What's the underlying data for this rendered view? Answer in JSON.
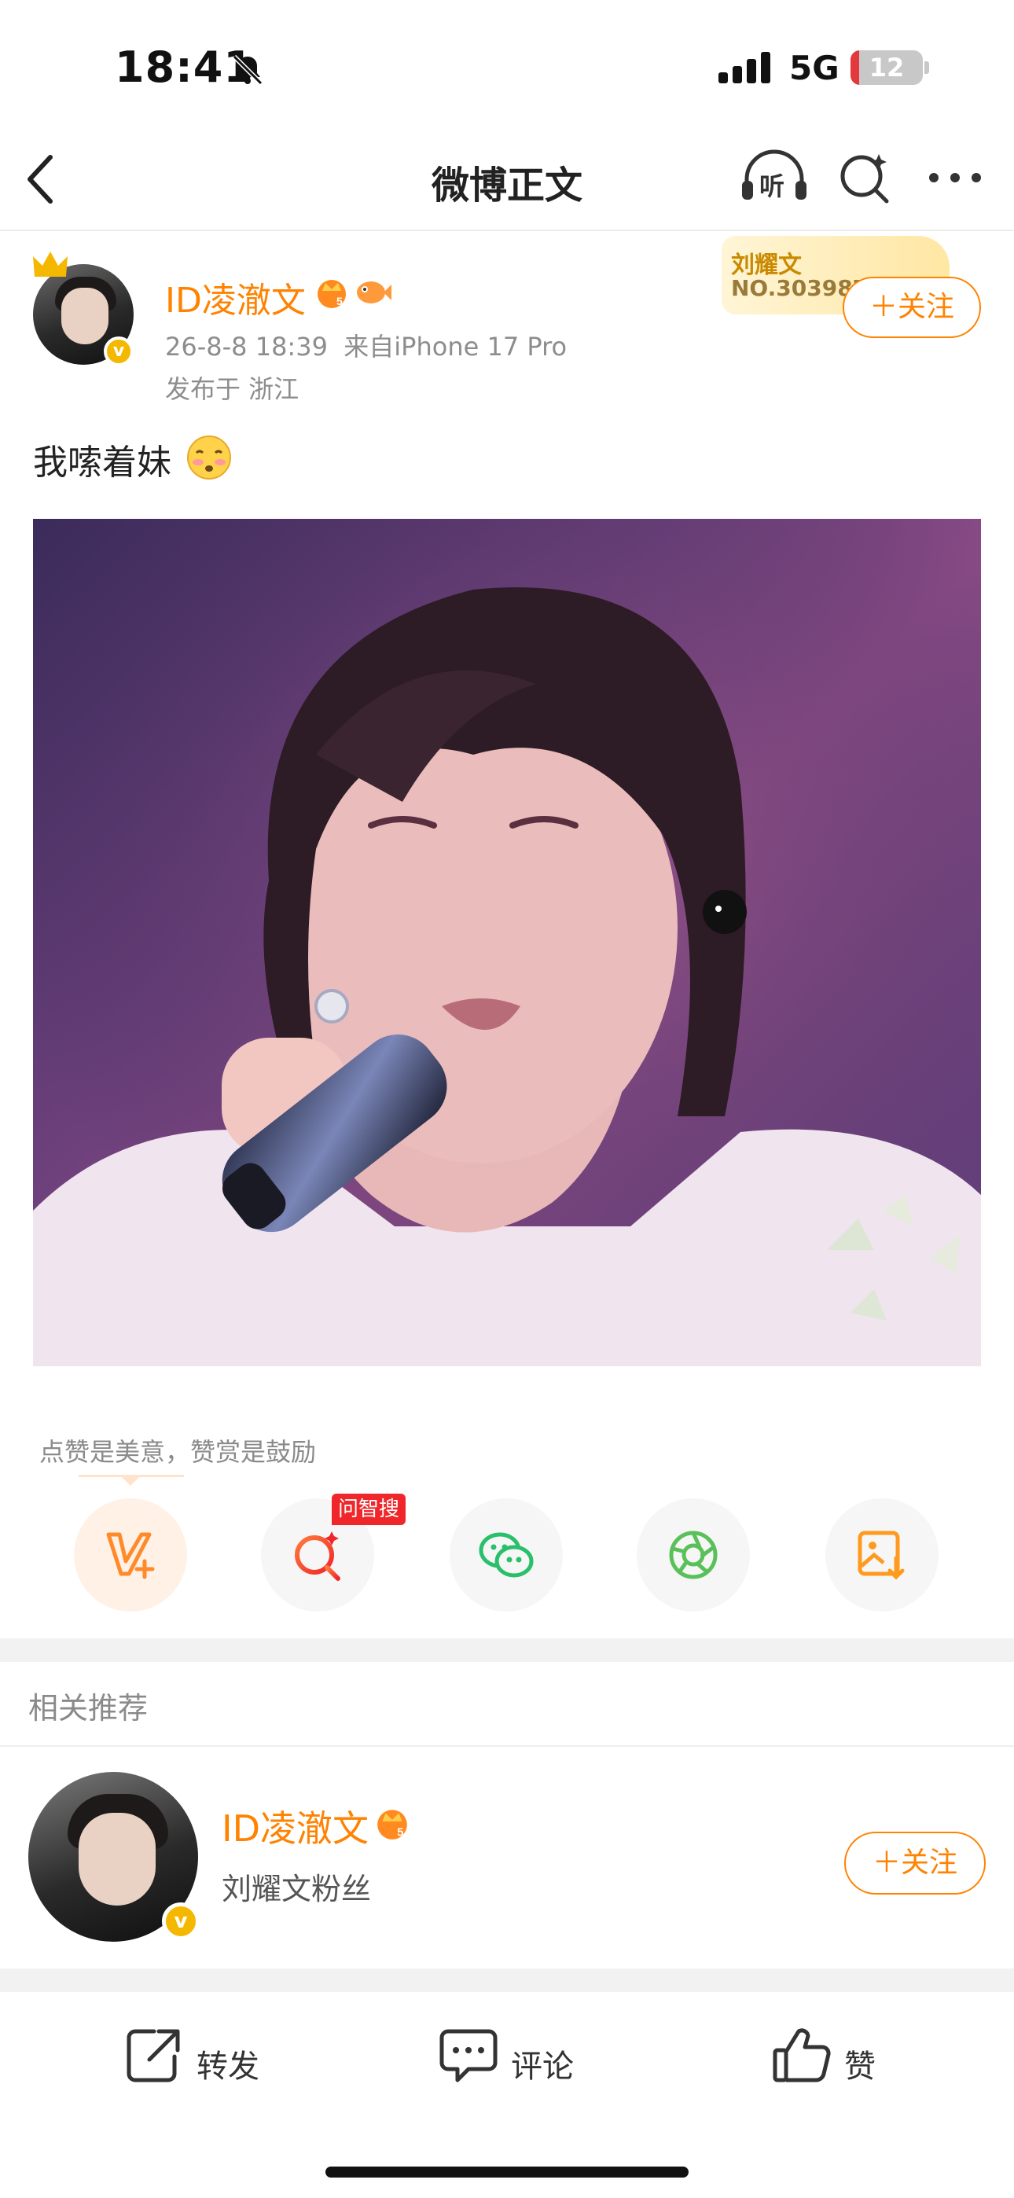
{
  "status_bar": {
    "time": "18:41",
    "network": "5G",
    "battery": "12",
    "battery_level_percent": 12
  },
  "nav": {
    "title": "微博正文",
    "listen_label": "听"
  },
  "post": {
    "username": "ID凌澈文",
    "timestamp": "26-8-8 18:39",
    "source": "来自iPhone 17 Pro",
    "location": "发布于 浙江",
    "fan_card_name": "刘耀文",
    "fan_card_number": "NO.303987",
    "follow_label": "＋关注",
    "text": "我嗦着妹"
  },
  "actions": {
    "tip": "点赞是美意，赞赏是鼓励",
    "ai_tag": "问智搜"
  },
  "related": {
    "title": "相关推荐",
    "name": "ID凌澈文",
    "description": "刘耀文粉丝",
    "follow_label": "＋关注"
  },
  "bottom_bar": {
    "repost": "转发",
    "comment": "评论",
    "like": "赞"
  },
  "colors": {
    "brand_orange": "#ff8200",
    "verified_yellow": "#f5b800",
    "ai_tag_red": "#f0272a"
  }
}
